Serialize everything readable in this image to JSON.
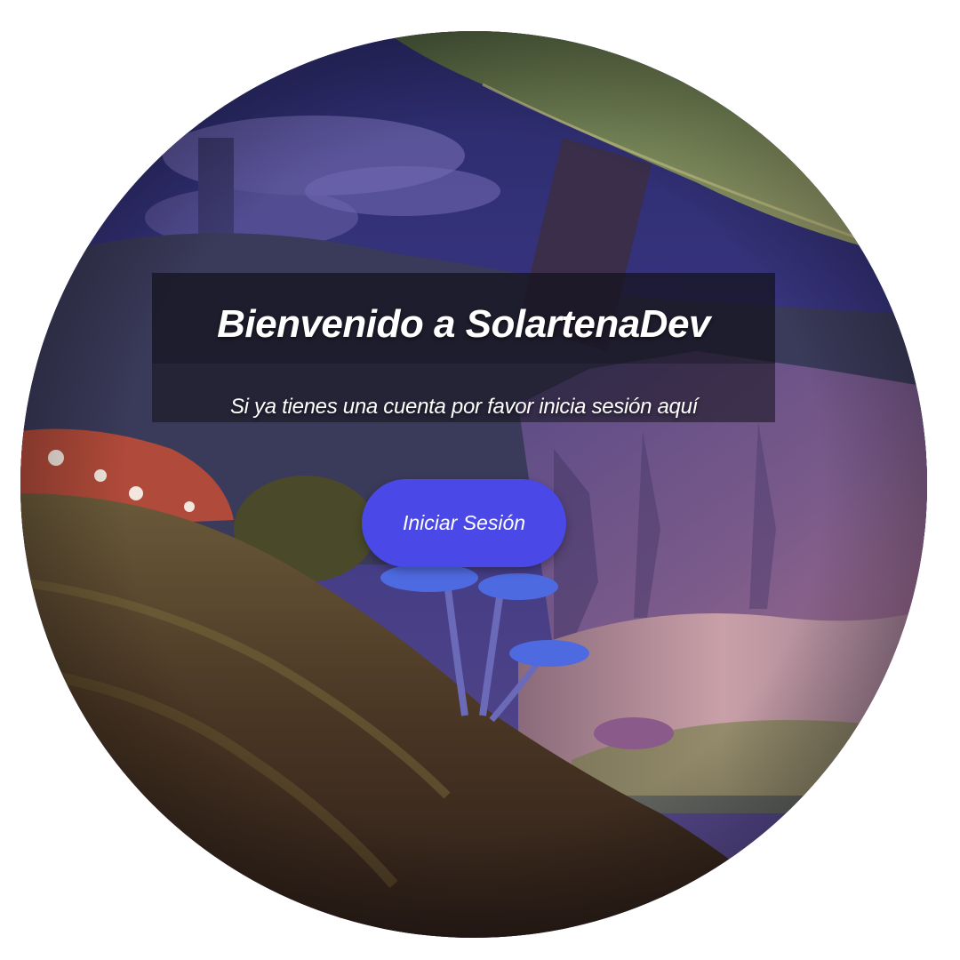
{
  "hero": {
    "title": "Bienvenido a SolartenaDev",
    "subtitle": "Si ya tienes una cuenta por favor inicia sesión aquí",
    "login_label": "Iniciar Sesión"
  },
  "background": {
    "description_icon": "fantasy-forest-scene",
    "colors": {
      "sky": "#3a3680",
      "cliffs": "#6a4a7a",
      "moss": "#5a4a2a",
      "accent_button": "#4a48e6"
    }
  }
}
